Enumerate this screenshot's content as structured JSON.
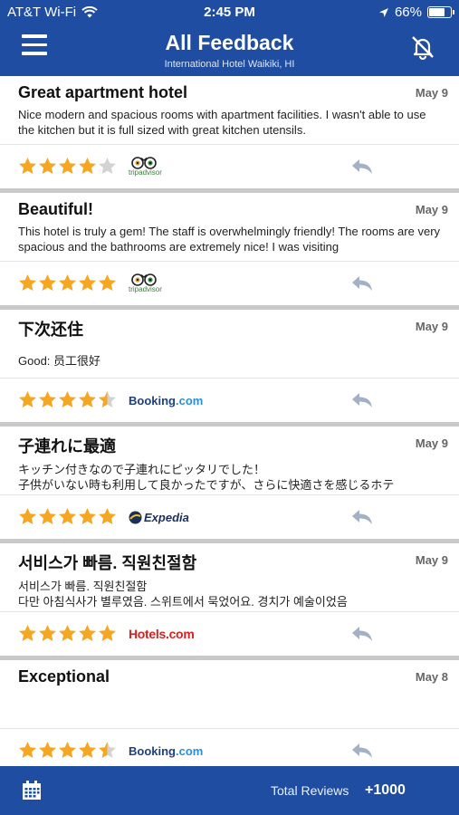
{
  "status": {
    "carrier": "AT&T Wi-Fi",
    "time": "2:45 PM",
    "battery": "66%",
    "battery_level": 0.66
  },
  "header": {
    "title": "All Feedback",
    "subtitle": "International Hotel Waikiki, HI"
  },
  "reviews": [
    {
      "title": "Great apartment hotel",
      "date": "May 9",
      "body": "Nice modern and spacious rooms with apartment facilities. I wasn't able to use the kitchen but it is full sized with great kitchen utensils.",
      "rating": 4,
      "source": "tripadvisor"
    },
    {
      "title": "Beautiful!",
      "date": "May 9",
      "body": "This hotel is truly a gem! The staff is overwhelmingly friendly! The rooms are very spacious and the bathrooms are extremely nice! I was visiting",
      "rating": 5,
      "source": "tripadvisor"
    },
    {
      "title": "下次还住",
      "date": "May 9",
      "body": "Good: 员工很好",
      "rating": 4.5,
      "source": "Booking.com"
    },
    {
      "title": "子連れに最適",
      "date": "May 9",
      "body": "キッチン付きなので子連れにピッタリでした！\n子供がいない時も利用して良かったですが、さらに快適さを感じるホテ",
      "rating": 5,
      "source": "Expedia"
    },
    {
      "title": "서비스가 빠름. 직원친절함",
      "date": "May 9",
      "body": "서비스가 빠름. 직원친절함\n다만 아침식사가 별루였음. 스위트에서 묵었어요. 경치가 예술이었음",
      "rating": 5,
      "source": "Hotels.com"
    },
    {
      "title": "Exceptional",
      "date": "May 8",
      "body": "",
      "rating": 4.5,
      "source": "Booking.com"
    }
  ],
  "footer": {
    "total_label": "Total Reviews",
    "total_value": "+1000"
  },
  "colors": {
    "brand": "#1e4da1",
    "star": "#f5a623",
    "star_empty": "#d3d3d3",
    "reply": "#a3b1c4"
  },
  "icons": {
    "menu": "hamburger-icon",
    "bell": "bell-off-icon",
    "reply": "reply-icon",
    "calendar": "calendar-icon",
    "wifi": "wifi-icon",
    "location": "location-arrow-icon"
  }
}
